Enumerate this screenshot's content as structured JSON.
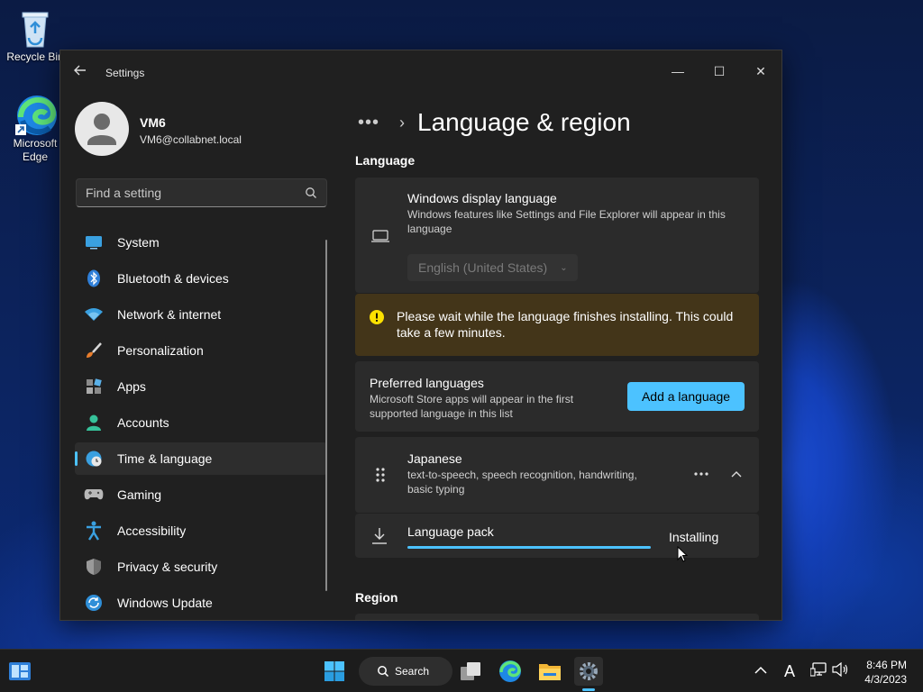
{
  "desktop": {
    "recycle_bin_label": "Recycle Bin",
    "edge_label": "Microsoft Edge"
  },
  "window": {
    "title": "Settings",
    "controls": {
      "minimize": "—",
      "maximize": "☐",
      "close": "✕"
    }
  },
  "profile": {
    "name": "VM6",
    "email": "VM6@collabnet.local"
  },
  "search": {
    "placeholder": "Find a setting"
  },
  "sidebar": {
    "items": [
      {
        "label": "System",
        "icon": "system-icon"
      },
      {
        "label": "Bluetooth & devices",
        "icon": "bluetooth-icon"
      },
      {
        "label": "Network & internet",
        "icon": "wifi-icon"
      },
      {
        "label": "Personalization",
        "icon": "brush-icon"
      },
      {
        "label": "Apps",
        "icon": "apps-icon"
      },
      {
        "label": "Accounts",
        "icon": "accounts-icon"
      },
      {
        "label": "Time & language",
        "icon": "time-language-icon",
        "active": true
      },
      {
        "label": "Gaming",
        "icon": "gamepad-icon"
      },
      {
        "label": "Accessibility",
        "icon": "accessibility-icon"
      },
      {
        "label": "Privacy & security",
        "icon": "shield-icon"
      },
      {
        "label": "Windows Update",
        "icon": "update-icon"
      }
    ]
  },
  "main": {
    "breadcrumb_dots": "•••",
    "breadcrumb_chevron": "›",
    "page_title": "Language & region",
    "language_section": "Language",
    "display_language": {
      "title": "Windows display language",
      "description": "Windows features like Settings and File Explorer will appear in this language",
      "selected": "English (United States)"
    },
    "warning": {
      "text": "Please wait while the language finishes installing. This could take a few minutes."
    },
    "preferred": {
      "title": "Preferred languages",
      "description": "Microsoft Store apps will appear in the first supported language in this list",
      "add_button": "Add a language"
    },
    "japanese": {
      "title": "Japanese",
      "description": "text-to-speech, speech recognition, handwriting, basic typing"
    },
    "language_pack": {
      "title": "Language pack",
      "status": "Installing"
    },
    "region_section": "Region"
  },
  "taskbar": {
    "search_label": "Search",
    "time": "8:46 PM",
    "date": "4/3/2023",
    "chevron": "^",
    "ime": "A"
  },
  "colors": {
    "accent": "#4cc2ff",
    "warning_bg": "#433519",
    "warning_icon": "#fce100",
    "window_bg": "#202020",
    "card_bg": "#2b2b2b"
  }
}
